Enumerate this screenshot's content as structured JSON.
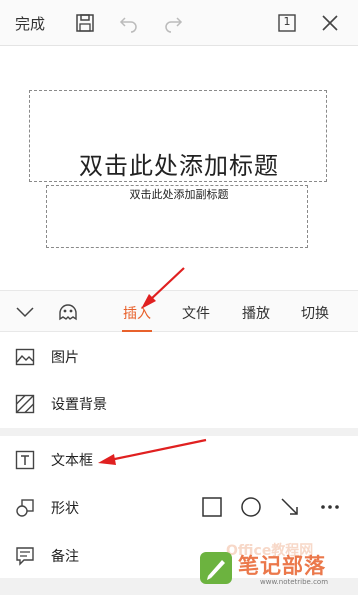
{
  "toolbar": {
    "done_label": "完成",
    "page_indicator": "1",
    "icons": [
      "save-icon",
      "undo-icon",
      "redo-icon",
      "page-count-icon",
      "close-icon"
    ]
  },
  "slide": {
    "title_placeholder": "双击此处添加标题",
    "subtitle_placeholder": "双击此处添加副标题"
  },
  "tabs": {
    "items": [
      {
        "label": "插入",
        "active": true
      },
      {
        "label": "文件",
        "active": false
      },
      {
        "label": "播放",
        "active": false
      },
      {
        "label": "切换",
        "active": false
      }
    ],
    "icons": [
      "collapse-chevron-icon",
      "emoji-face-icon"
    ]
  },
  "menu": {
    "items": [
      {
        "label": "图片",
        "icon": "image-icon"
      },
      {
        "label": "设置背景",
        "icon": "background-icon"
      },
      {
        "label": "文本框",
        "icon": "textbox-icon"
      },
      {
        "label": "形状",
        "icon": "shapes-icon"
      },
      {
        "label": "备注",
        "icon": "notes-icon"
      }
    ],
    "shape_options": [
      "rectangle-icon",
      "circle-icon",
      "arrow-line-icon",
      "more-icon"
    ]
  },
  "watermark": {
    "title": "笔记部落",
    "ghost": "Office教程网",
    "url": "www.notetribe.com"
  },
  "colors": {
    "accent": "#e8612c",
    "annotation": "#e02020",
    "toolbar_bg": "#fafafa",
    "divider": "#f1f1f1"
  }
}
